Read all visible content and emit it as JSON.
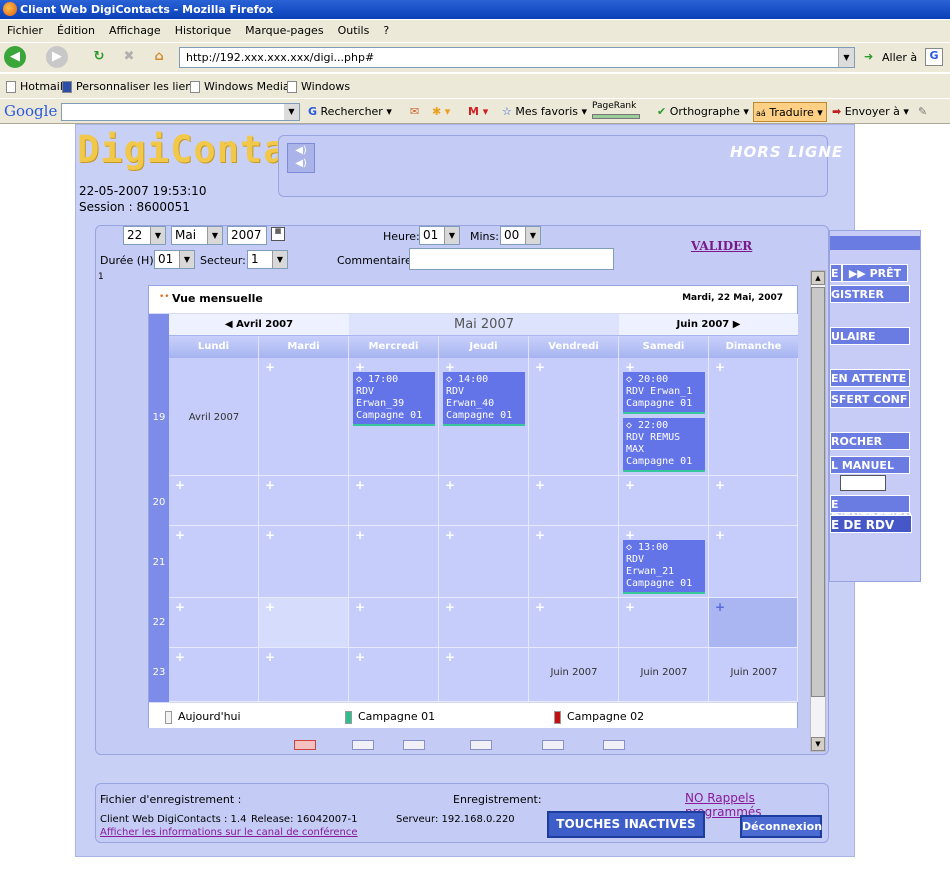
{
  "window": {
    "title": "Client Web DigiContacts - Mozilla Firefox"
  },
  "menu": [
    "Fichier",
    "Édition",
    "Affichage",
    "Historique",
    "Marque-pages",
    "Outils",
    "?"
  ],
  "nav": {
    "url": "http://192.xxx.xxx.xxx/digi...php#",
    "go_label": "Aller à"
  },
  "bookmarks": [
    "Hotmail",
    "Personnaliser les liens",
    "Windows Media",
    "Windows"
  ],
  "google_toolbar": {
    "logo": "Google",
    "search_label": "Rechercher",
    "favorites": "Mes favoris",
    "pagerank": "PageRank",
    "spell": "Orthographe",
    "translate": "Traduire",
    "send": "Envoyer à"
  },
  "app": {
    "logo_text": "DigiContacts",
    "status": "HORS LIGNE",
    "datetime": "22-05-2007 19:53:10",
    "session": "Session : 8600051"
  },
  "form": {
    "day": "22",
    "month": "Mai",
    "year": "2007",
    "heure_label": "Heure:",
    "heure": "01",
    "mins_label": "Mins:",
    "mins": "00",
    "duree_label": "Durée (H):",
    "duree": "01",
    "secteur_label": "Secteur:",
    "secteur": "1",
    "commentaires_label": "Commentaires",
    "valider": "VALIDER",
    "counter": "1"
  },
  "calendar": {
    "view_title": "Vue mensuelle",
    "current_date": "Mardi, 22 Mai, 2007",
    "prev_month": "Avril 2007",
    "month": "Mai 2007",
    "next_month": "Juin 2007",
    "weekdays": [
      "Lundi",
      "Mardi",
      "Mercredi",
      "Jeudi",
      "Vendredi",
      "Samedi",
      "Dimanche"
    ],
    "weeks": [
      "19",
      "20",
      "21",
      "22",
      "23"
    ],
    "cell_texts": {
      "w19_mon": "Avril 2007",
      "w23_fri": "Juin 2007",
      "w23_sat": "Juin 2007",
      "w23_sun": "Juin 2007"
    },
    "events": [
      {
        "time": "17:00",
        "title": "RDV",
        "who": "Erwan_39",
        "campaign": "Campagne 01"
      },
      {
        "time": "14:00",
        "title": "RDV",
        "who": "Erwan_40",
        "campaign": "Campagne 01"
      },
      {
        "time": "20:00",
        "title": "RDV Erwan_1",
        "who": "",
        "campaign": "Campagne 01"
      },
      {
        "time": "22:00",
        "title": "RDV REMUS",
        "who": "MAX",
        "campaign": "Campagne 01"
      },
      {
        "time": "13:00",
        "title": "RDV",
        "who": "Erwan_21",
        "campaign": "Campagne 01"
      }
    ],
    "legend": [
      {
        "label": "Aujourd'hui",
        "color": "#f2f2f2"
      },
      {
        "label": "Campagne 01",
        "color": "#2fbf8f"
      },
      {
        "label": "Campagne 02",
        "color": "#c41010"
      }
    ]
  },
  "right_panel": {
    "pret": "PRÊT",
    "buttons": [
      "E",
      "GISTRER",
      "ULAIRE",
      "EN ATTENTE",
      "SFERT CONF",
      "ROCHER",
      "L MANUEL",
      "E D'ENTRETIEN",
      "E DE RDV"
    ]
  },
  "bottom": {
    "fichier_label": "Fichier d'enregistrement :",
    "enregistrement_label": "Enregistrement:",
    "no_rappels": "NO Rappels programmés",
    "client_version": "Client Web DigiContacts : 1.4",
    "release": "Release: 16042007-1",
    "serveur": "Serveur: 192.168.0.220",
    "conf_link": "Afficher les informations sur le canal de conférence",
    "touches": "TOUCHES INACTIVES",
    "deconnexion": "Déconnexion"
  }
}
